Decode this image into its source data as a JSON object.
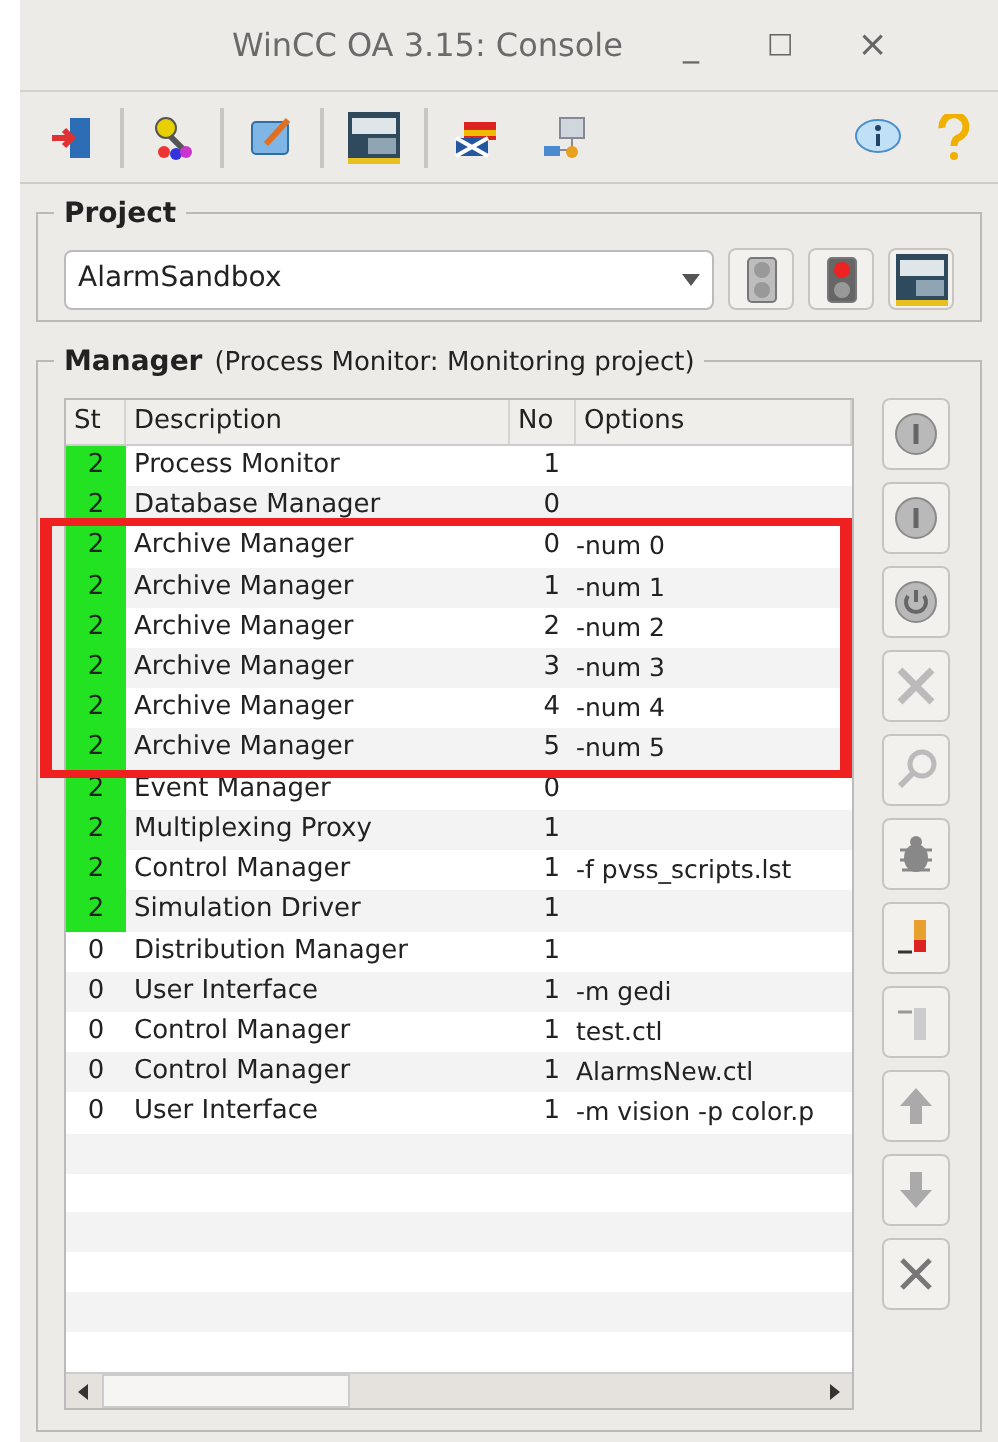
{
  "window": {
    "title": "WinCC OA 3.15: Console",
    "controls": [
      "_",
      "□",
      "×"
    ]
  },
  "project": {
    "legend": "Project",
    "selected_project": "AlarmSandbox"
  },
  "manager": {
    "legend": "Manager",
    "subtitle": "(Process Monitor: Monitoring project)",
    "table": {
      "columns": [
        "St",
        "Description",
        "No",
        "Options"
      ],
      "rows": [
        {
          "status": "2",
          "running": true,
          "description": "Process Monitor",
          "no": "1",
          "options": ""
        },
        {
          "status": "2",
          "running": true,
          "description": "Database Manager",
          "no": "0",
          "options": ""
        },
        {
          "status": "2",
          "running": true,
          "description": "Archive Manager",
          "no": "0",
          "options": "-num 0"
        },
        {
          "status": "2",
          "running": true,
          "description": "Archive Manager",
          "no": "1",
          "options": "-num 1"
        },
        {
          "status": "2",
          "running": true,
          "description": "Archive Manager",
          "no": "2",
          "options": "-num 2"
        },
        {
          "status": "2",
          "running": true,
          "description": "Archive Manager",
          "no": "3",
          "options": "-num 3"
        },
        {
          "status": "2",
          "running": true,
          "description": "Archive Manager",
          "no": "4",
          "options": "-num 4"
        },
        {
          "status": "2",
          "running": true,
          "description": "Archive Manager",
          "no": "5",
          "options": "-num 5"
        },
        {
          "status": "2",
          "running": true,
          "description": "Event Manager",
          "no": "0",
          "options": ""
        },
        {
          "status": "2",
          "running": true,
          "description": "Multiplexing Proxy",
          "no": "1",
          "options": ""
        },
        {
          "status": "2",
          "running": true,
          "description": "Control Manager",
          "no": "1",
          "options": "-f pvss_scripts.lst"
        },
        {
          "status": "2",
          "running": true,
          "description": "Simulation Driver",
          "no": "1",
          "options": ""
        },
        {
          "status": "0",
          "running": false,
          "description": "Distribution Manager",
          "no": "1",
          "options": ""
        },
        {
          "status": "0",
          "running": false,
          "description": "User Interface",
          "no": "1",
          "options": "-m gedi"
        },
        {
          "status": "0",
          "running": false,
          "description": "Control Manager",
          "no": "1",
          "options": "test.ctl"
        },
        {
          "status": "0",
          "running": false,
          "description": "Control Manager",
          "no": "1",
          "options": "AlarmsNew.ctl"
        },
        {
          "status": "0",
          "running": false,
          "description": "User Interface",
          "no": "1",
          "options": "-m vision -p color.p"
        }
      ]
    }
  }
}
